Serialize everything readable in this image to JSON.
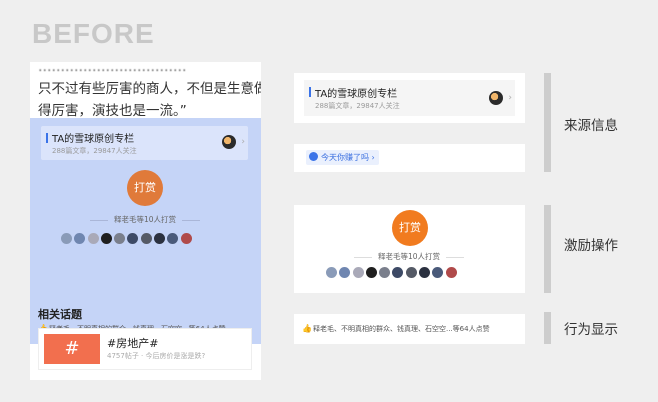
{
  "heading": "BEFORE",
  "quote_lines": [
    "……………………………",
    "只不过有些厉害的商人，不但是生意做",
    "得厉害，演技也是一流。”"
  ],
  "column_card": {
    "title": "TA的雪球原创专栏",
    "subtitle": "288篇文章，29847人关注",
    "chevron": "›"
  },
  "earn_pill": {
    "text": "今天你赚了吗",
    "chevron": "›"
  },
  "tip": {
    "button_label": "打赏",
    "count_text": "释老毛等10人打赏",
    "avatar_colors": [
      "#8a9bb8",
      "#6f86b0",
      "#a9a9b8",
      "#1f1f1f",
      "#7a7f8c",
      "#3d4a66",
      "#555a66",
      "#2b3140",
      "#4a5a7a",
      "#b04a4a"
    ]
  },
  "likes_text": "释老毛、不明真相的群众、钱真理、石空空...等64人点赞",
  "related": {
    "heading": "相关话题",
    "topic_glyph": "#",
    "topic_name": "#房地产#",
    "topic_sub": "4757帖子 · 今后房价是涨是跌?"
  },
  "section_labels": {
    "source": "来源信息",
    "incentive": "激励操作",
    "behavior": "行为显示"
  },
  "colors": {
    "highlight": "#c5d4f7",
    "tip_orange": "#f17b1f",
    "accent_blue": "#3a73e8",
    "topic_red": "#f26f4e"
  }
}
